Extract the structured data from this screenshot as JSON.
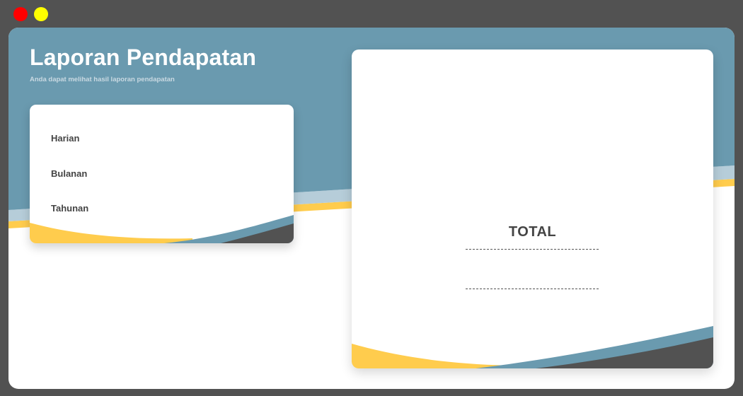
{
  "window_controls": {
    "close_color": "#ff0000",
    "minimize_color": "#ffff00"
  },
  "colors": {
    "background": "#525252",
    "header_blue": "#6a9aaf",
    "light_blue": "#b6cdd9",
    "accent_yellow": "#ffcc4d",
    "dark_gray": "#525252",
    "text_dark": "#444444"
  },
  "header": {
    "title": "Laporan Pendapatan",
    "subtitle": "Anda dapat melihat hasil laporan pendapatan"
  },
  "menu": {
    "items": [
      {
        "label": "Harian"
      },
      {
        "label": "Bulanan"
      },
      {
        "label": "Tahunan"
      }
    ]
  },
  "total_panel": {
    "label": "TOTAL",
    "value": ""
  }
}
